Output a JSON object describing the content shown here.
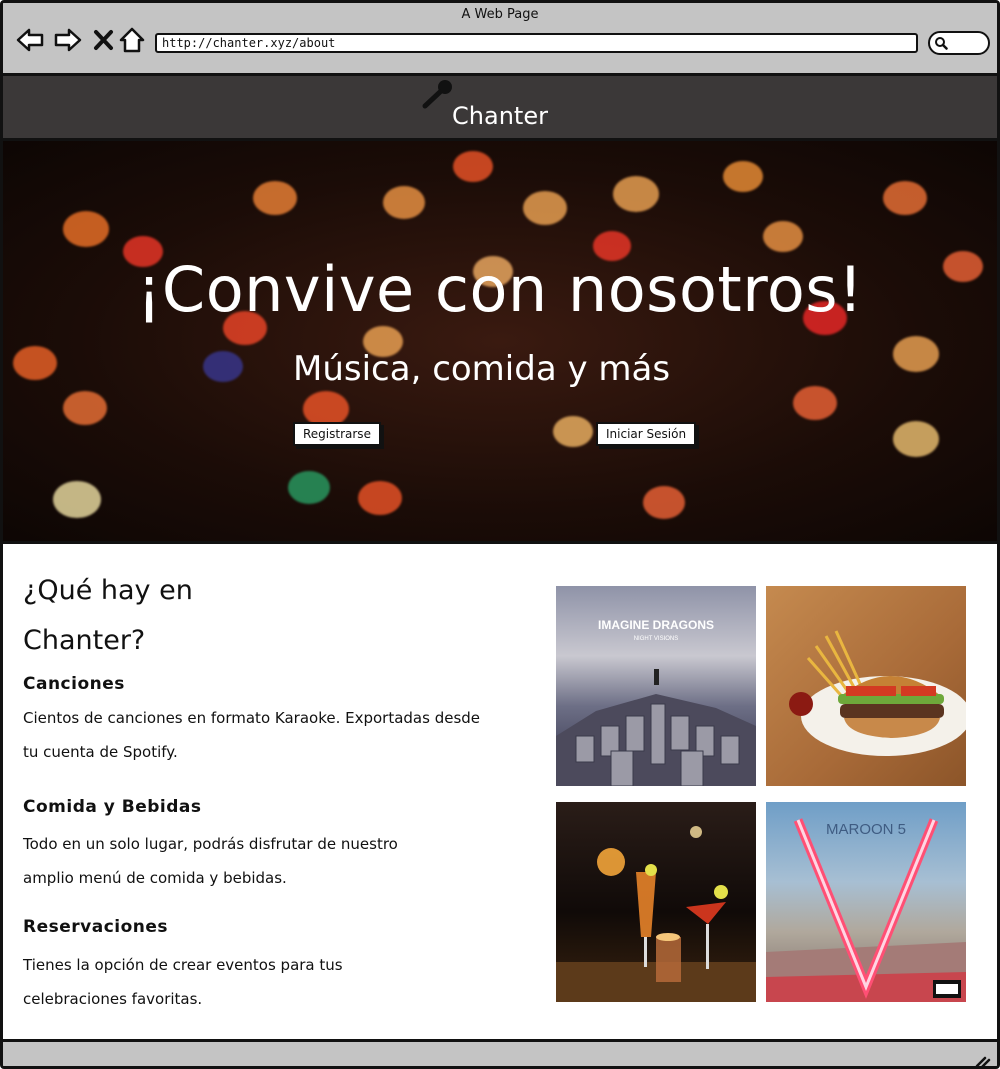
{
  "window": {
    "title": "A Web Page"
  },
  "browser": {
    "url": "http://chanter.xyz/about",
    "nav_icons": [
      "back-arrow-icon",
      "forward-arrow-icon",
      "close-x-icon",
      "home-icon",
      "search-icon"
    ]
  },
  "site": {
    "brand": "Chanter",
    "brand_icon": "microphone-icon"
  },
  "hero": {
    "title": "¡Convive con nosotros!",
    "subtitle": "Música, comida y más",
    "register_label": "Registrarse",
    "login_label": "Iniciar Sesión"
  },
  "about": {
    "title": "¿Qué hay en Chanter?",
    "items": [
      {
        "heading": "Canciones",
        "text": "Cientos de canciones en formato Karaoke. Exportadas desde tu cuenta de Spotify."
      },
      {
        "heading": "Comida y Bebidas",
        "text": "Todo en un solo lugar, podrás disfrutar de nuestro amplio menú de comida y bebidas."
      },
      {
        "heading": "Reservaciones",
        "text": "Tienes la opción de crear eventos para tus celebraciones favoritas."
      }
    ],
    "images": [
      {
        "name": "album-cover-imagine-dragons",
        "text": "IMAGINE DRAGONS",
        "subtext": "NIGHT VISIONS"
      },
      {
        "name": "burger-photo"
      },
      {
        "name": "cocktails-photo"
      },
      {
        "name": "album-cover-maroon5",
        "text": "MAROON 5"
      }
    ]
  },
  "colors": {
    "header_bg": "#3b3838",
    "chrome_bg": "#c4c4c4",
    "hero_bg": "#1b0c07"
  }
}
